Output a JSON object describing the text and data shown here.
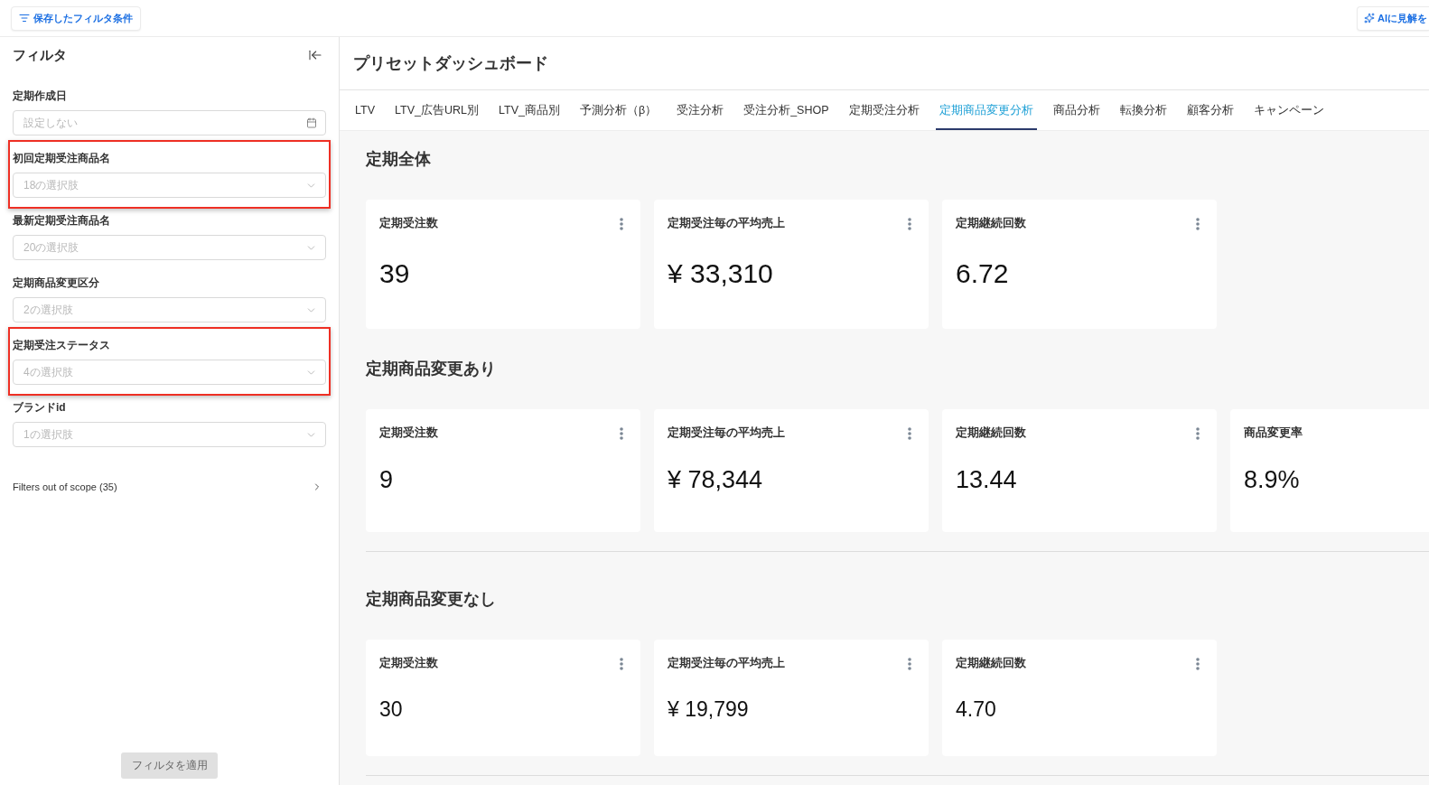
{
  "top_bar": {
    "saved_filters_button": "保存したフィルタ条件",
    "ai_button": "AIに見解を"
  },
  "sidebar": {
    "title": "フィルタ",
    "filters": [
      {
        "kind": "date",
        "label": "定期作成日",
        "placeholder": "設定しない",
        "highlighted": false
      },
      {
        "kind": "select",
        "label": "初回定期受注商品名",
        "placeholder": "18の選択肢",
        "highlighted": true
      },
      {
        "kind": "select",
        "label": "最新定期受注商品名",
        "placeholder": "20の選択肢",
        "highlighted": false
      },
      {
        "kind": "select",
        "label": "定期商品変更区分",
        "placeholder": "2の選択肢",
        "highlighted": false
      },
      {
        "kind": "select",
        "label": "定期受注ステータス",
        "placeholder": "4の選択肢",
        "highlighted": true
      },
      {
        "kind": "select",
        "label": "ブランドid",
        "placeholder": "1の選択肢",
        "highlighted": false
      }
    ],
    "out_of_scope": "Filters out of scope (35)",
    "apply_button": {
      "label": "フィルタを適用",
      "disabled": true
    }
  },
  "dashboard": {
    "title": "プリセットダッシュボード",
    "tabs": [
      {
        "label": "LTV",
        "selected": false
      },
      {
        "label": "LTV_広告URL別",
        "selected": false
      },
      {
        "label": "LTV_商品別",
        "selected": false
      },
      {
        "label": "予測分析（β）",
        "selected": false
      },
      {
        "label": "受注分析",
        "selected": false
      },
      {
        "label": "受注分析_SHOP",
        "selected": false
      },
      {
        "label": "定期受注分析",
        "selected": false
      },
      {
        "label": "定期商品変更分析",
        "selected": true
      },
      {
        "label": "商品分析",
        "selected": false
      },
      {
        "label": "転換分析",
        "selected": false
      },
      {
        "label": "顧客分析",
        "selected": false
      },
      {
        "label": "キャンペーン",
        "selected": false
      }
    ],
    "sections": [
      {
        "title": "定期全体",
        "divider": false,
        "cards": [
          {
            "title": "定期受注数",
            "value": "39",
            "menu": true
          },
          {
            "title": "定期受注毎の平均売上",
            "value": "¥ 33,310",
            "menu": true
          },
          {
            "title": "定期継続回数",
            "value": "6.72",
            "menu": true
          }
        ]
      },
      {
        "title": "定期商品変更あり",
        "divider": true,
        "cards": [
          {
            "title": "定期受注数",
            "value": "9",
            "menu": true
          },
          {
            "title": "定期受注毎の平均売上",
            "value": "¥ 78,344",
            "menu": true
          },
          {
            "title": "定期継続回数",
            "value": "13.44",
            "menu": true
          },
          {
            "title": "商品変更率",
            "value": "8.9%",
            "menu": false
          }
        ]
      },
      {
        "title": "定期商品変更なし",
        "divider": true,
        "cards": [
          {
            "title": "定期受注数",
            "value": "30",
            "menu": true
          },
          {
            "title": "定期受注毎の平均売上",
            "value": "¥ 19,799",
            "menu": true
          },
          {
            "title": "定期継続回数",
            "value": "4.70",
            "menu": true
          }
        ]
      }
    ]
  }
}
